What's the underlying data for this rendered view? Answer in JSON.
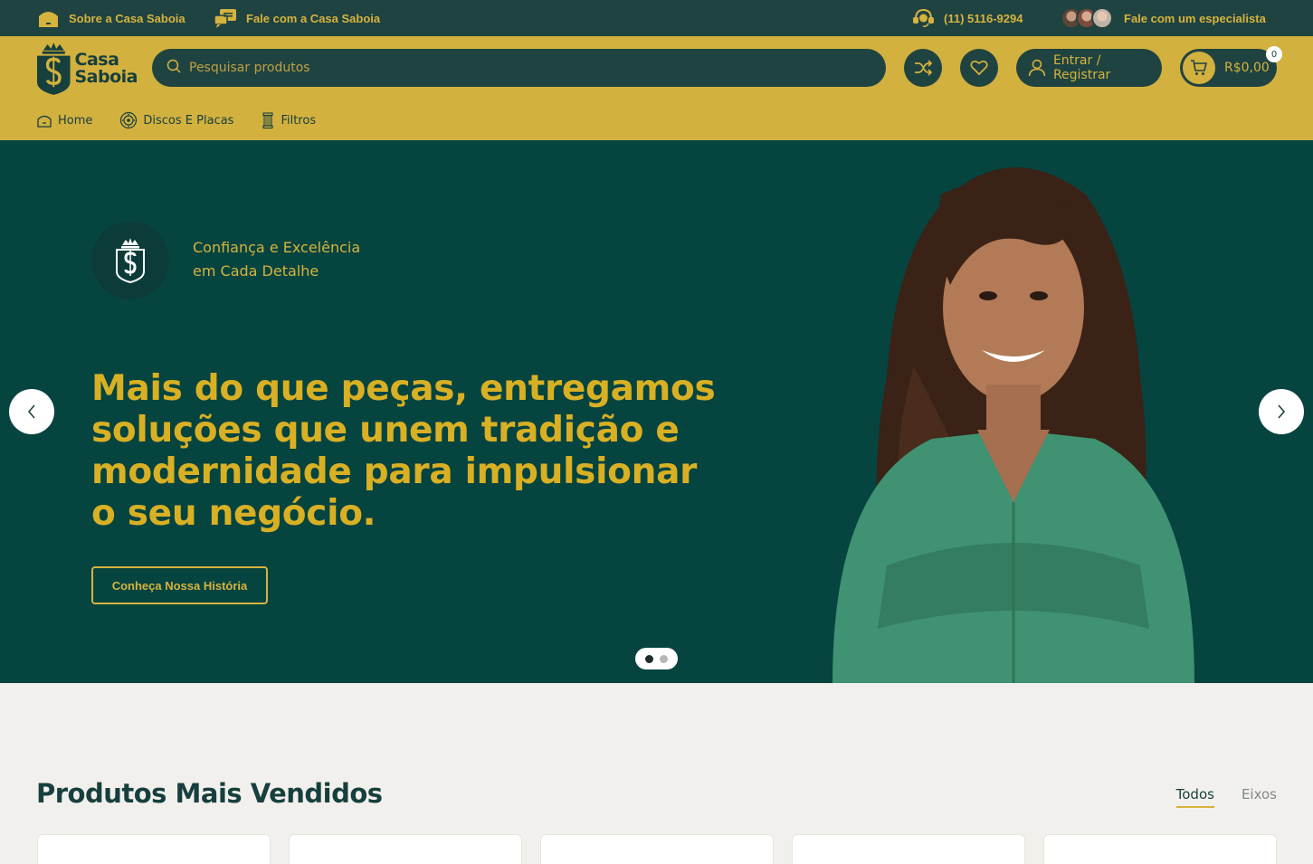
{
  "topbar": {
    "about": "Sobre a Casa Saboia",
    "contact": "Fale com a Casa Saboia",
    "phone": "(11) 5116-9294",
    "specialist": "Fale com um especialista"
  },
  "header": {
    "logo_line1": "Casa",
    "logo_line2": "Saboia",
    "search_placeholder": "Pesquisar produtos",
    "login_label": "Entrar / Registrar",
    "cart_total": "R$0,00",
    "cart_count": "0"
  },
  "nav": {
    "items": [
      {
        "label": "Home",
        "icon": "home-icon"
      },
      {
        "label": "Discos E Placas",
        "icon": "disc-icon"
      },
      {
        "label": "Filtros",
        "icon": "filter-icon"
      }
    ]
  },
  "hero": {
    "tagline_line1": "Confiança e Excelência",
    "tagline_line2": "em Cada Detalhe",
    "headline_line1": "Mais do que peças, entregamos",
    "headline_line2": "soluções que unem tradição e",
    "headline_line3": "modernidade para impulsionar",
    "headline_line4": "o seu negócio.",
    "cta": "Conheça Nossa História",
    "slides_total": 2,
    "active_slide": 1
  },
  "products": {
    "title": "Produtos Mais Vendidos",
    "tabs": [
      {
        "label": "Todos",
        "active": true
      },
      {
        "label": "Eixos",
        "active": false
      }
    ]
  },
  "colors": {
    "dark_green": "#1f4341",
    "hero_green": "#064440",
    "gold": "#d3b13f",
    "headline_gold": "#d9b024",
    "background": "#f2f0ec"
  }
}
